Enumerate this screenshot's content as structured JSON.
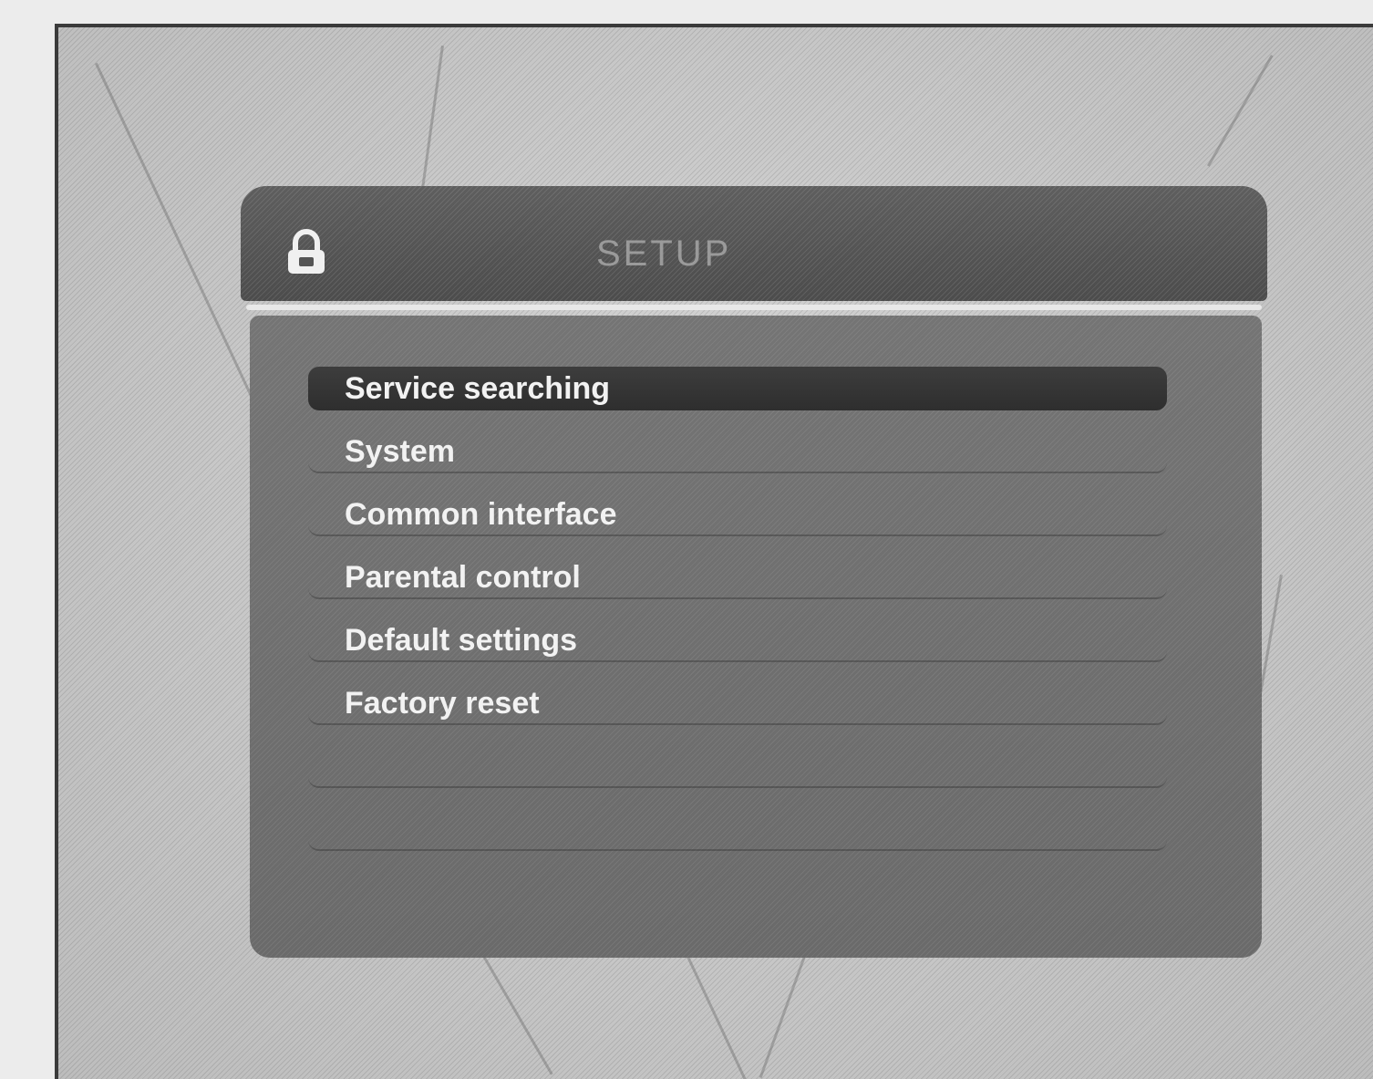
{
  "osd": {
    "title": "SETUP",
    "menu_items": [
      {
        "label": "Service searching",
        "selected": true
      },
      {
        "label": "System",
        "selected": false
      },
      {
        "label": "Common interface",
        "selected": false
      },
      {
        "label": "Parental control",
        "selected": false
      },
      {
        "label": "Default settings",
        "selected": false
      },
      {
        "label": "Factory reset",
        "selected": false
      }
    ],
    "header_icon": "lock-icon"
  },
  "colors": {
    "header_bg": "#555555",
    "body_bg": "#6f6f6f",
    "highlight_bg": "#333333",
    "text": "#f2f2f2",
    "separator": "#e8e8e8"
  }
}
